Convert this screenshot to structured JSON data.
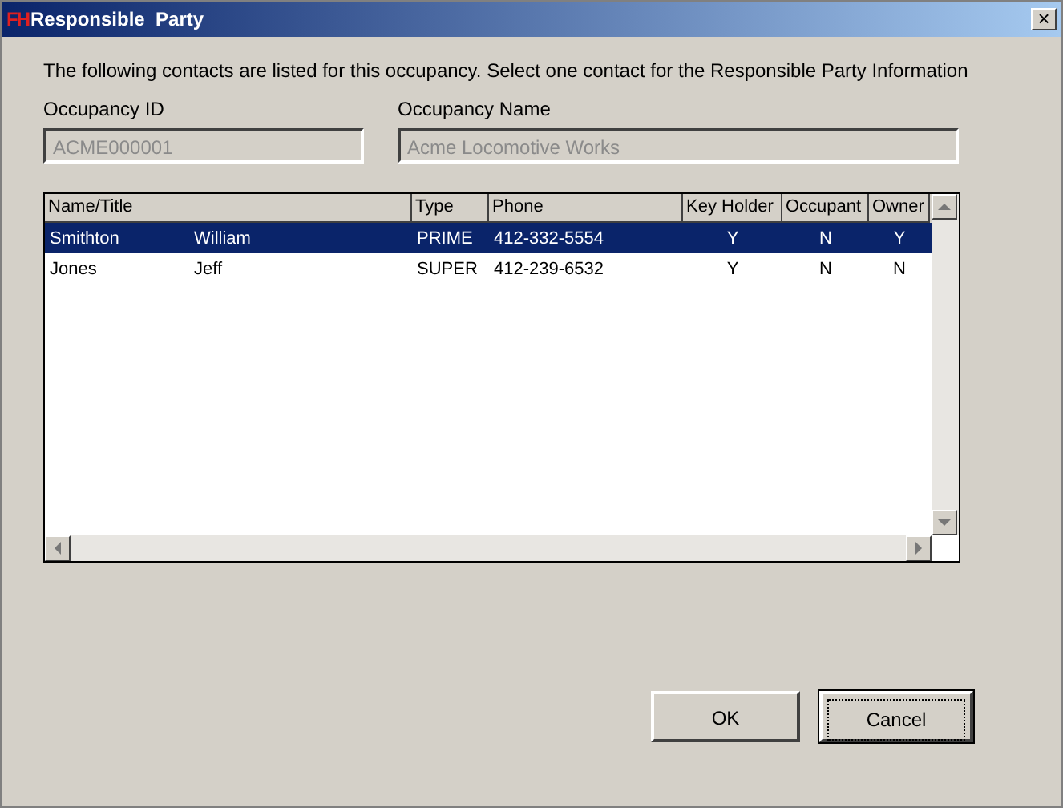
{
  "window": {
    "logo": "FH",
    "title": "Responsible  Party",
    "close": "×"
  },
  "instructions": "The following contacts are listed for this occupancy. Select one contact for the Responsible Party Information",
  "fields": [
    {
      "label": "Occupancy ID",
      "value": "ACME000001",
      "disabled": true
    },
    {
      "label": "Occupancy Name",
      "value": "Acme Locomotive Works",
      "disabled": true
    }
  ],
  "table": {
    "columns": [
      "Name/Title",
      "Type",
      "Phone",
      "Key Holder",
      "Occupant",
      "Owner"
    ],
    "rows": [
      {
        "last_name": "Smithton",
        "first_name": "William",
        "type": "PRIME",
        "phone": "412-332-5554",
        "key_holder": "Y",
        "occupant": "N",
        "owner": "Y",
        "selected": true
      },
      {
        "last_name": "Jones",
        "first_name": "Jeff",
        "type": "SUPER",
        "phone": "412-239-6532",
        "key_holder": "Y",
        "occupant": "N",
        "owner": "N",
        "selected": false
      }
    ]
  },
  "buttons": [
    {
      "label": "OK",
      "default": false
    },
    {
      "label": "Cancel",
      "default": true
    }
  ]
}
